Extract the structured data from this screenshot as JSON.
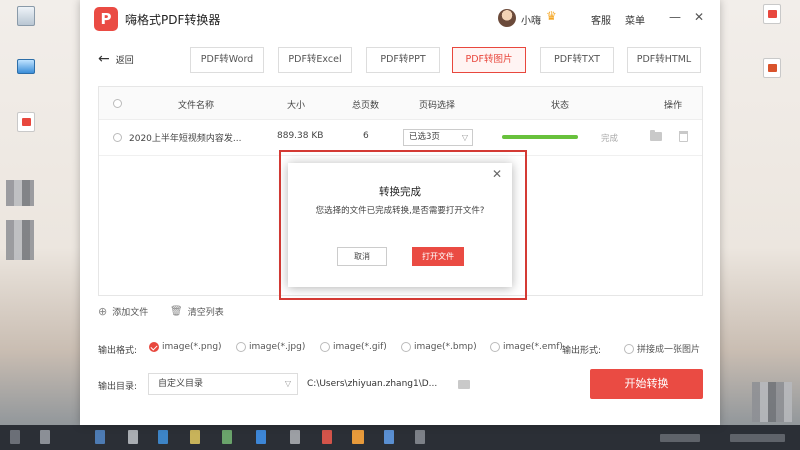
{
  "app": {
    "title": "嗨格式PDF转换器",
    "user_name": "小嗨",
    "service_label": "客服",
    "menu_label": "菜单",
    "window_buttons": {
      "minimize": "—",
      "close": "✕"
    }
  },
  "nav": {
    "back_label": "返回",
    "tabs": [
      {
        "label": "PDF转Word"
      },
      {
        "label": "PDF转Excel"
      },
      {
        "label": "PDF转PPT"
      },
      {
        "label": "PDF转图片"
      },
      {
        "label": "PDF转TXT"
      },
      {
        "label": "PDF转HTML"
      }
    ],
    "active_tab": "PDF转图片"
  },
  "table": {
    "headers": {
      "file_name": "文件名称",
      "size": "大小",
      "pages": "总页数",
      "page_select": "页码选择",
      "status": "状态",
      "actions": "操作"
    },
    "rows": [
      {
        "file_name": "2020上半年短视频内容发...",
        "size": "889.38 KB",
        "pages": "6",
        "page_select": "已选3页",
        "progress": 1.0,
        "status": "完成"
      }
    ]
  },
  "file_actions": {
    "add_label": "添加文件",
    "clear_label": "清空列表"
  },
  "format": {
    "label": "输出格式:",
    "options": [
      {
        "label": "image(*.png)",
        "selected": true
      },
      {
        "label": "image(*.jpg)",
        "selected": false
      },
      {
        "label": "image(*.gif)",
        "selected": false
      },
      {
        "label": "image(*.bmp)",
        "selected": false
      },
      {
        "label": "image(*.emf)",
        "selected": false
      }
    ],
    "form_label": "输出形式:",
    "form_option": "拼接成一张图片"
  },
  "output": {
    "label": "输出目录:",
    "dir_select": "自定义目录",
    "path": "C:\\Users\\zhiyuan.zhang1\\D...",
    "start_label": "开始转换"
  },
  "dialog": {
    "title": "转换完成",
    "message": "您选择的文件已完成转换,是否需要打开文件?",
    "cancel_label": "取消",
    "open_label": "打开文件",
    "close_label": "✕"
  },
  "colors": {
    "brand_red": "#ea4b43",
    "progress_green": "#68c13c"
  }
}
